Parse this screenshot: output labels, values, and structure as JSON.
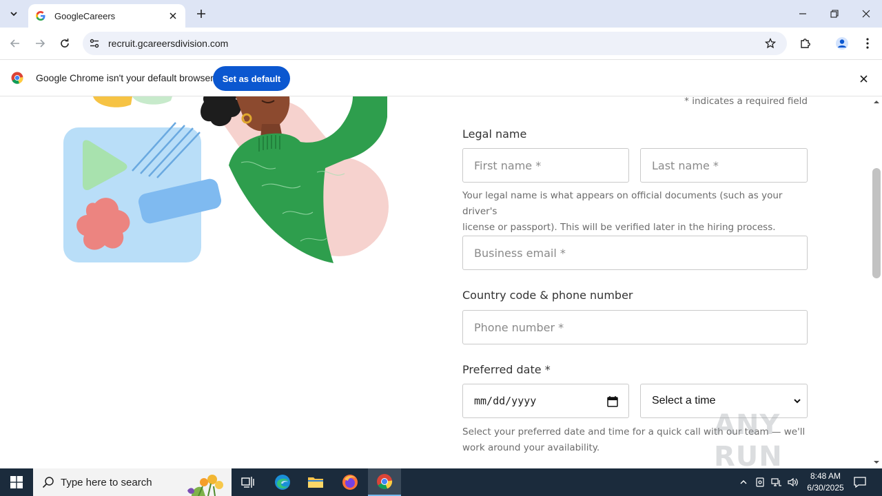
{
  "browser": {
    "tab": {
      "title": "GoogleCareers"
    },
    "url": "recruit.gcareersdivision.com"
  },
  "infobar": {
    "message": "Google Chrome isn't your default browser",
    "button_label": "Set as default"
  },
  "form": {
    "required_note": "* indicates a required field",
    "legal_name_label": "Legal name",
    "first_name_placeholder": "First name *",
    "last_name_placeholder": "Last name *",
    "legal_name_help_line1": "Your legal name is what appears on official documents (such as your driver's",
    "legal_name_help_line2": "license or passport). This will be verified later in the hiring process.",
    "business_email_placeholder": "Business email *",
    "phone_label": "Country code & phone number",
    "phone_placeholder": "Phone number *",
    "preferred_date_label": "Preferred date *",
    "date_value": "mm/dd/yyyy",
    "time_select_value": "Select a time",
    "date_help_line1": "Select your preferred date and time for a quick call with our team — we'll",
    "date_help_line2": "work around your availability."
  },
  "watermark": "ANY RUN",
  "taskbar": {
    "search_placeholder": "Type here to search",
    "time": "8:48 AM",
    "date": "6/30/2025"
  },
  "colors": {
    "titlebar": "#dee5f5",
    "accent_button": "#0b57d0",
    "taskbar": "#1b2b3c"
  }
}
